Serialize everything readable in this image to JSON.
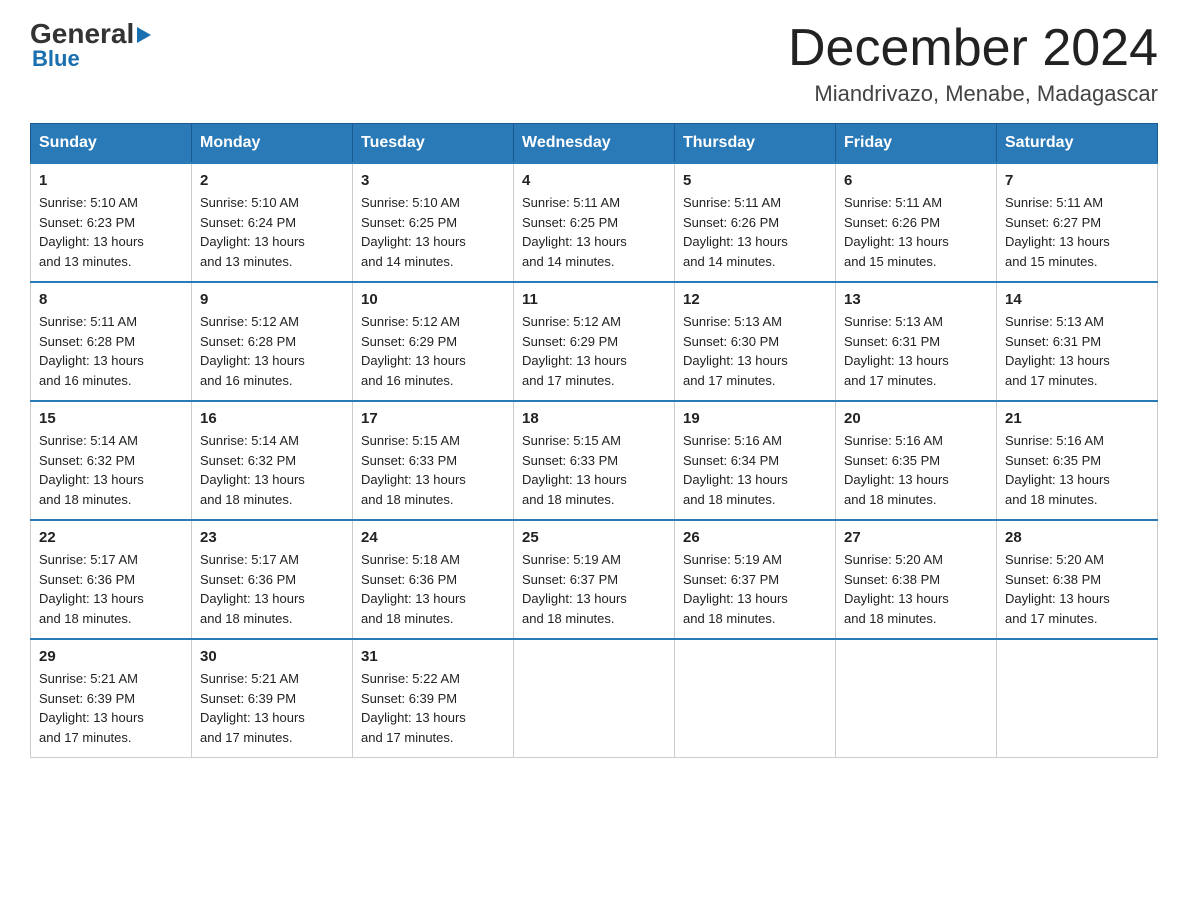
{
  "header": {
    "logo_line1": "General",
    "logo_line2": "Blue",
    "month_title": "December 2024",
    "location": "Miandrivazo, Menabe, Madagascar"
  },
  "days_of_week": [
    "Sunday",
    "Monday",
    "Tuesday",
    "Wednesday",
    "Thursday",
    "Friday",
    "Saturday"
  ],
  "weeks": [
    [
      {
        "day": "1",
        "sunrise": "5:10 AM",
        "sunset": "6:23 PM",
        "daylight": "13 hours and 13 minutes."
      },
      {
        "day": "2",
        "sunrise": "5:10 AM",
        "sunset": "6:24 PM",
        "daylight": "13 hours and 13 minutes."
      },
      {
        "day": "3",
        "sunrise": "5:10 AM",
        "sunset": "6:25 PM",
        "daylight": "13 hours and 14 minutes."
      },
      {
        "day": "4",
        "sunrise": "5:11 AM",
        "sunset": "6:25 PM",
        "daylight": "13 hours and 14 minutes."
      },
      {
        "day": "5",
        "sunrise": "5:11 AM",
        "sunset": "6:26 PM",
        "daylight": "13 hours and 14 minutes."
      },
      {
        "day": "6",
        "sunrise": "5:11 AM",
        "sunset": "6:26 PM",
        "daylight": "13 hours and 15 minutes."
      },
      {
        "day": "7",
        "sunrise": "5:11 AM",
        "sunset": "6:27 PM",
        "daylight": "13 hours and 15 minutes."
      }
    ],
    [
      {
        "day": "8",
        "sunrise": "5:11 AM",
        "sunset": "6:28 PM",
        "daylight": "13 hours and 16 minutes."
      },
      {
        "day": "9",
        "sunrise": "5:12 AM",
        "sunset": "6:28 PM",
        "daylight": "13 hours and 16 minutes."
      },
      {
        "day": "10",
        "sunrise": "5:12 AM",
        "sunset": "6:29 PM",
        "daylight": "13 hours and 16 minutes."
      },
      {
        "day": "11",
        "sunrise": "5:12 AM",
        "sunset": "6:29 PM",
        "daylight": "13 hours and 17 minutes."
      },
      {
        "day": "12",
        "sunrise": "5:13 AM",
        "sunset": "6:30 PM",
        "daylight": "13 hours and 17 minutes."
      },
      {
        "day": "13",
        "sunrise": "5:13 AM",
        "sunset": "6:31 PM",
        "daylight": "13 hours and 17 minutes."
      },
      {
        "day": "14",
        "sunrise": "5:13 AM",
        "sunset": "6:31 PM",
        "daylight": "13 hours and 17 minutes."
      }
    ],
    [
      {
        "day": "15",
        "sunrise": "5:14 AM",
        "sunset": "6:32 PM",
        "daylight": "13 hours and 18 minutes."
      },
      {
        "day": "16",
        "sunrise": "5:14 AM",
        "sunset": "6:32 PM",
        "daylight": "13 hours and 18 minutes."
      },
      {
        "day": "17",
        "sunrise": "5:15 AM",
        "sunset": "6:33 PM",
        "daylight": "13 hours and 18 minutes."
      },
      {
        "day": "18",
        "sunrise": "5:15 AM",
        "sunset": "6:33 PM",
        "daylight": "13 hours and 18 minutes."
      },
      {
        "day": "19",
        "sunrise": "5:16 AM",
        "sunset": "6:34 PM",
        "daylight": "13 hours and 18 minutes."
      },
      {
        "day": "20",
        "sunrise": "5:16 AM",
        "sunset": "6:35 PM",
        "daylight": "13 hours and 18 minutes."
      },
      {
        "day": "21",
        "sunrise": "5:16 AM",
        "sunset": "6:35 PM",
        "daylight": "13 hours and 18 minutes."
      }
    ],
    [
      {
        "day": "22",
        "sunrise": "5:17 AM",
        "sunset": "6:36 PM",
        "daylight": "13 hours and 18 minutes."
      },
      {
        "day": "23",
        "sunrise": "5:17 AM",
        "sunset": "6:36 PM",
        "daylight": "13 hours and 18 minutes."
      },
      {
        "day": "24",
        "sunrise": "5:18 AM",
        "sunset": "6:36 PM",
        "daylight": "13 hours and 18 minutes."
      },
      {
        "day": "25",
        "sunrise": "5:19 AM",
        "sunset": "6:37 PM",
        "daylight": "13 hours and 18 minutes."
      },
      {
        "day": "26",
        "sunrise": "5:19 AM",
        "sunset": "6:37 PM",
        "daylight": "13 hours and 18 minutes."
      },
      {
        "day": "27",
        "sunrise": "5:20 AM",
        "sunset": "6:38 PM",
        "daylight": "13 hours and 18 minutes."
      },
      {
        "day": "28",
        "sunrise": "5:20 AM",
        "sunset": "6:38 PM",
        "daylight": "13 hours and 17 minutes."
      }
    ],
    [
      {
        "day": "29",
        "sunrise": "5:21 AM",
        "sunset": "6:39 PM",
        "daylight": "13 hours and 17 minutes."
      },
      {
        "day": "30",
        "sunrise": "5:21 AM",
        "sunset": "6:39 PM",
        "daylight": "13 hours and 17 minutes."
      },
      {
        "day": "31",
        "sunrise": "5:22 AM",
        "sunset": "6:39 PM",
        "daylight": "13 hours and 17 minutes."
      },
      null,
      null,
      null,
      null
    ]
  ],
  "labels": {
    "sunrise": "Sunrise:",
    "sunset": "Sunset:",
    "daylight": "Daylight:"
  }
}
